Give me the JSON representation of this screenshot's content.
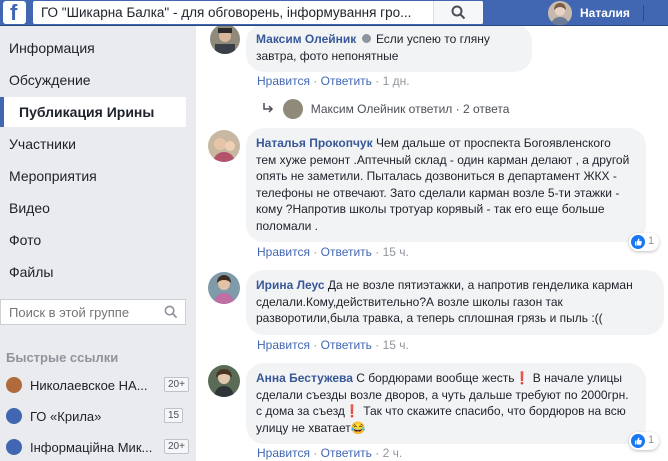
{
  "header": {
    "search_value": "ГО \"Шикарна Балка\" - для обговорень, інформування гро...",
    "user_name": "Наталия",
    "brand_color": "#4267b2"
  },
  "sidebar": {
    "items": [
      {
        "label": "Информация"
      },
      {
        "label": "Обсуждение"
      },
      {
        "label": "Публикация Ирины"
      },
      {
        "label": "Участники"
      },
      {
        "label": "Мероприятия"
      },
      {
        "label": "Видео"
      },
      {
        "label": "Фото"
      },
      {
        "label": "Файлы"
      }
    ],
    "search_placeholder": "Поиск в этой группе",
    "quick_links_title": "Быстрые ссылки",
    "quick_links": [
      {
        "label": "Николаевское НА...",
        "count": "20+"
      },
      {
        "label": "ГО «Крила»",
        "count": "15"
      },
      {
        "label": "Інформаційна Мик...",
        "count": "20+"
      }
    ]
  },
  "comments": [
    {
      "author": "Максим Олейник",
      "text": "Если успею то гляну завтра, фото непонятные",
      "like": "Нравится",
      "reply": "Ответить",
      "time": "1 дн.",
      "thread": {
        "author": "Максим Олейник ответил",
        "replies": "2 ответа"
      }
    },
    {
      "author": "Наталья Прокопчук",
      "text": "Чем дальше от проспекта Богоявленского тем хуже ремонт .Аптечный склад - один карман делают , а другой опять не заметили. Пыталась дозвониться в департамент ЖКХ - телефоны не отвечают. Зато сделали карман возле 5-ти этажки - кому ?Напротив школы тротуар корявый - так его еще больше поломали .",
      "like": "Нравится",
      "reply": "Ответить",
      "time": "15 ч.",
      "reactions": "1"
    },
    {
      "author": "Ирина Леус",
      "text": "Да не возле пятиэтажки, а напротив генделика карман сделали.Кому,действительно?А возле школы газон так разворотили,была травка, а теперь сплошная грязь и пыль :((",
      "like": "Нравится",
      "reply": "Ответить",
      "time": "15 ч."
    },
    {
      "author": "Анна Бестужева",
      "text": "С бордюрами вообще жесть❗  В начале улицы сделали съезды возле дворов, а чуть дальше требуют по 2000грн. с дома за съезд❗  Так что скажите спасибо, что бордюров на всю улицу не хватает😂",
      "like": "Нравится",
      "reply": "Ответить",
      "time": "2 ч.",
      "reactions": "1"
    }
  ],
  "separator": "·"
}
